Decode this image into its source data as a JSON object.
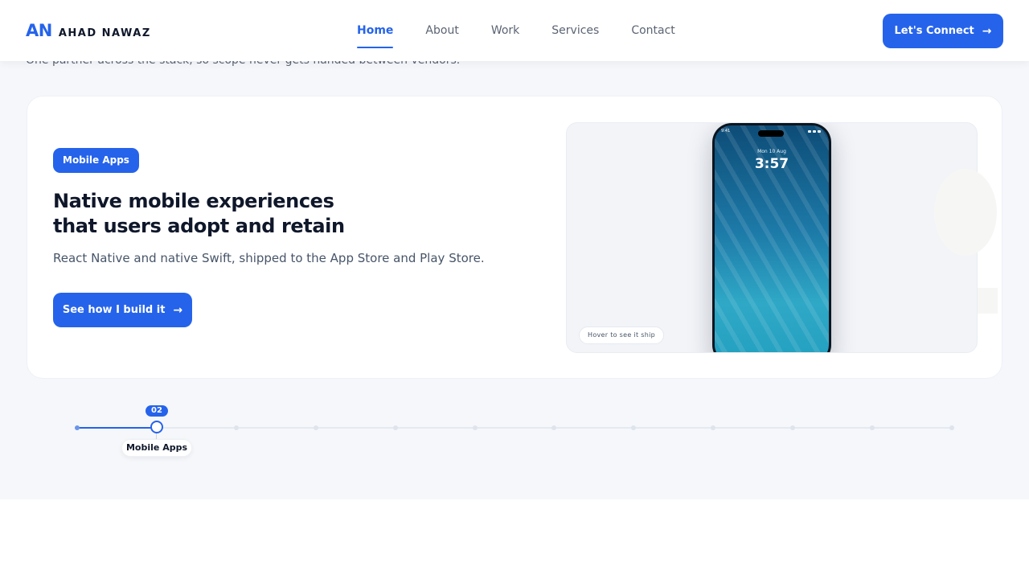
{
  "header": {
    "logo_mark": "AN",
    "logo_name": "AHAD NAWAZ",
    "nav": [
      {
        "label": "Home",
        "active": true
      },
      {
        "label": "About",
        "active": false
      },
      {
        "label": "Work",
        "active": false
      },
      {
        "label": "Services",
        "active": false
      },
      {
        "label": "Contact",
        "active": false
      }
    ],
    "cta_label": "Let's Connect",
    "cta_icon": "arrow-right-icon"
  },
  "section": {
    "subline": "One partner across the stack, so scope never gets handed between vendors."
  },
  "service_card": {
    "badge": "Mobile Apps",
    "title_line1": "Native mobile experiences",
    "title_line2": "that users adopt and retain",
    "description": "React Native and native Swift, shipped to the App Store and Play Store.",
    "button_label": "See how I build it",
    "button_icon": "arrow-right-icon",
    "phone": {
      "status_time": "9:41",
      "date": "Mon 10 Aug",
      "time": "3:57"
    },
    "hover_hint": "Hover to see it ship"
  },
  "timeline": {
    "current_number": "02",
    "current_label": "Mobile Apps",
    "current_step": 2,
    "total_steps": 12
  },
  "colors": {
    "accent": "#2563eb",
    "background": "#f5f7fb",
    "text_primary": "#0f172a",
    "text_secondary": "#475569"
  }
}
